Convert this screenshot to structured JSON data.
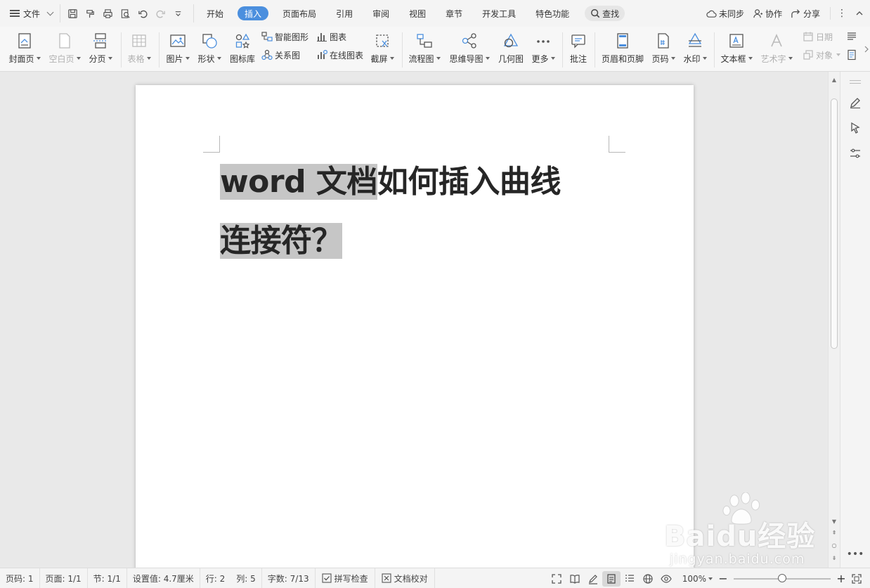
{
  "menubar": {
    "file_label": "文件",
    "tabs": [
      "开始",
      "插入",
      "页面布局",
      "引用",
      "审阅",
      "视图",
      "章节",
      "开发工具",
      "特色功能"
    ],
    "active_tab": "插入",
    "search_label": "查找",
    "sync_label": "未同步",
    "collab_label": "协作",
    "share_label": "分享"
  },
  "ribbon": {
    "cover": "封面页",
    "blank": "空白页",
    "pagebreak": "分页",
    "table": "表格",
    "picture": "图片",
    "shape": "形状",
    "iconlib": "图标库",
    "smartart": "智能图形",
    "relation": "关系图",
    "chart": "图表",
    "onlinechart": "在线图表",
    "screenshot": "截屏",
    "flowchart": "流程图",
    "mindmap": "思维导图",
    "geometry": "几何图",
    "more": "更多",
    "comment": "批注",
    "headerfooter": "页眉和页脚",
    "pagenum": "页码",
    "watermark": "水印",
    "textbox": "文本框",
    "wordart": "艺术字",
    "date": "日期",
    "object": "对象"
  },
  "document": {
    "title_selected": "word 文档",
    "title_rest": "如何插入曲线",
    "title_line2": "连接符？"
  },
  "watermark": {
    "main": "Baidu经验",
    "sub": "jingyan.baidu.com"
  },
  "statusbar": {
    "page_num": "页码: 1",
    "pages": "页面: 1/1",
    "section": "节: 1/1",
    "setting": "设置值: 4.7厘米",
    "row": "行: 2",
    "col": "列: 5",
    "words": "字数: 7/13",
    "spellcheck": "拼写检查",
    "proofread": "文档校对",
    "zoom": "100%",
    "zoom_level": 0.5
  },
  "colors": {
    "accent": "#4b8fde",
    "selection": "#c6c6c6"
  }
}
